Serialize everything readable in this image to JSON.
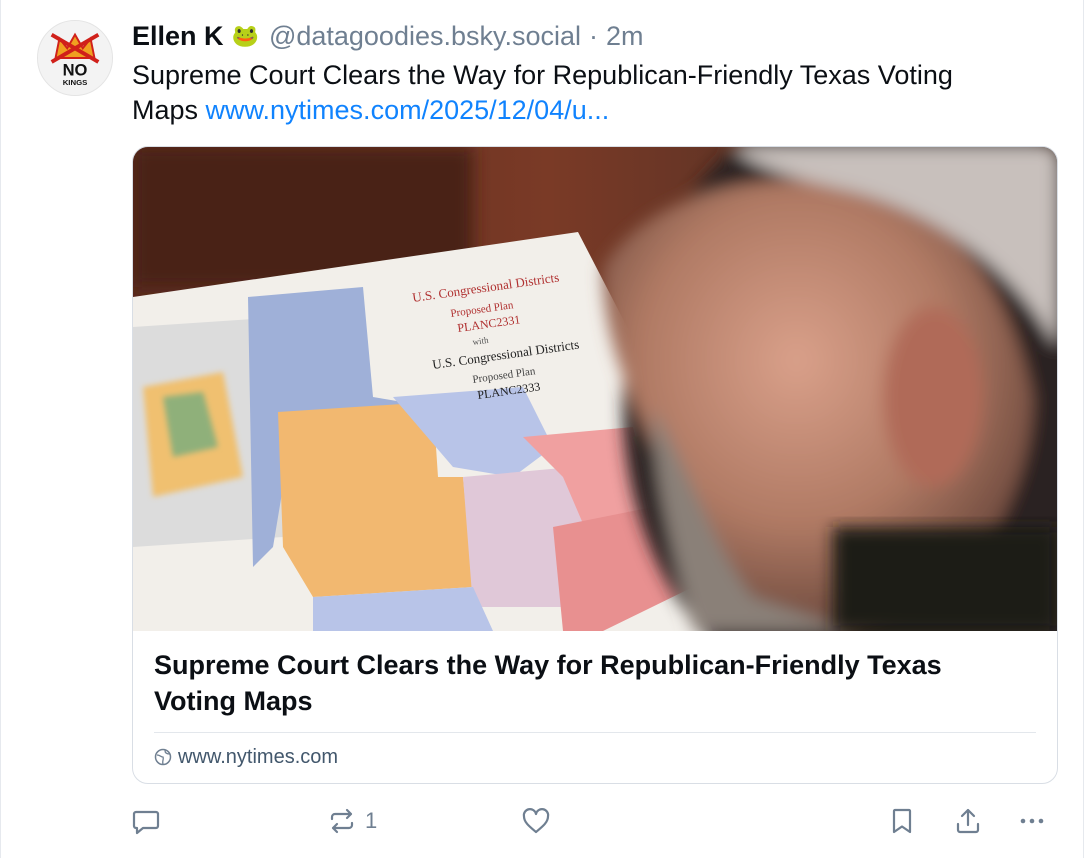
{
  "author": {
    "name": "Ellen K",
    "emoji": "🐸",
    "handle": "@datagoodies.bsky.social",
    "separator": "·",
    "time": "2m",
    "avatar_text_top": "NO",
    "avatar_text_bottom": "KINGS"
  },
  "post": {
    "text": "Supreme Court Clears the Way for Republican-Friendly Texas Voting Maps ",
    "link_text": "www.nytimes.com/2025/12/04/u..."
  },
  "card": {
    "title": "Supreme Court Clears the Way for Republican-Friendly Texas Voting Maps",
    "domain": "www.nytimes.com",
    "map_text": {
      "line1": "U.S. Congressional Districts",
      "line2": "Proposed Plan",
      "line3": "PLANC2331",
      "line4": "with",
      "line5": "U.S. Congressional Districts",
      "line6": "Proposed Plan",
      "line7": "PLANC2333"
    }
  },
  "actions": {
    "reply_icon": "speech-bubble-icon",
    "repost_icon": "repost-arrows-icon",
    "repost_count": "1",
    "like_icon": "heart-icon",
    "bookmark_icon": "bookmark-icon",
    "share_icon": "share-upload-icon",
    "more_icon": "ellipsis-icon"
  },
  "colors": {
    "link": "#1083fe",
    "muted": "#6f7f91",
    "text": "#0b0f14"
  }
}
